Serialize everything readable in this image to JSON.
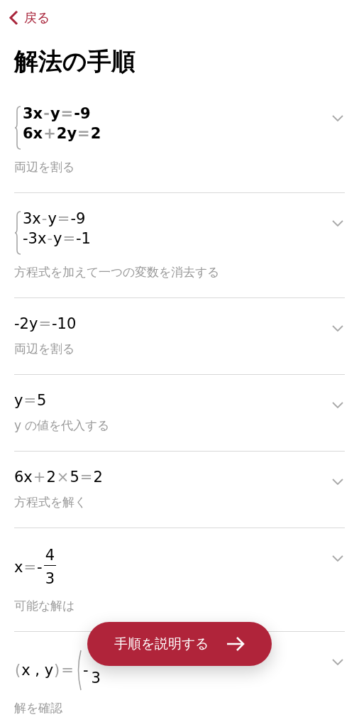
{
  "nav": {
    "back_label": "戻る"
  },
  "title": "解法の手順",
  "steps": [
    {
      "kind": "system",
      "bold": true,
      "expanded": false,
      "lines": [
        [
          {
            "t": "3x",
            "kind": "term"
          },
          {
            "t": "-",
            "kind": "op"
          },
          {
            "t": "y",
            "kind": "term"
          },
          {
            "t": "=",
            "kind": "op"
          },
          {
            "t": "-9",
            "kind": "term"
          }
        ],
        [
          {
            "t": "6x",
            "kind": "term"
          },
          {
            "t": "+",
            "kind": "op"
          },
          {
            "t": "2y",
            "kind": "term"
          },
          {
            "t": "=",
            "kind": "op"
          },
          {
            "t": "2",
            "kind": "term"
          }
        ]
      ],
      "note": "両辺を割る"
    },
    {
      "kind": "system",
      "bold": false,
      "expanded": false,
      "lines": [
        [
          {
            "t": "3x",
            "kind": "term"
          },
          {
            "t": "-",
            "kind": "op"
          },
          {
            "t": "y",
            "kind": "term"
          },
          {
            "t": "=",
            "kind": "op"
          },
          {
            "t": "-9",
            "kind": "term"
          }
        ],
        [
          {
            "t": "-3x",
            "kind": "term"
          },
          {
            "t": "-",
            "kind": "op"
          },
          {
            "t": "y",
            "kind": "term"
          },
          {
            "t": "=",
            "kind": "op"
          },
          {
            "t": "-1",
            "kind": "term"
          }
        ]
      ],
      "note": "方程式を加えて一つの変数を消去する"
    },
    {
      "kind": "line",
      "bold": false,
      "expanded": false,
      "lines": [
        [
          {
            "t": "-2y",
            "kind": "term"
          },
          {
            "t": "=",
            "kind": "op"
          },
          {
            "t": "-10",
            "kind": "term"
          }
        ]
      ],
      "note": "両辺を割る"
    },
    {
      "kind": "line",
      "bold": false,
      "expanded": false,
      "lines": [
        [
          {
            "t": "y",
            "kind": "term"
          },
          {
            "t": "=",
            "kind": "op"
          },
          {
            "t": "5",
            "kind": "term"
          }
        ]
      ],
      "note": "y の値を代入する"
    },
    {
      "kind": "line",
      "bold": false,
      "expanded": false,
      "lines": [
        [
          {
            "t": "6x",
            "kind": "term"
          },
          {
            "t": "+",
            "kind": "op"
          },
          {
            "t": "2",
            "kind": "term"
          },
          {
            "t": "×",
            "kind": "op"
          },
          {
            "t": "5",
            "kind": "term"
          },
          {
            "t": "=",
            "kind": "op"
          },
          {
            "t": "2",
            "kind": "term"
          }
        ]
      ],
      "note": "方程式を解く"
    },
    {
      "kind": "line",
      "bold": false,
      "expanded": false,
      "lines": [
        [
          {
            "t": "x",
            "kind": "term"
          },
          {
            "t": "=",
            "kind": "op"
          },
          {
            "t": "-",
            "kind": "term"
          }
        ]
      ],
      "fraction": {
        "num": "4",
        "den": "3"
      },
      "note": "可能な解は"
    },
    {
      "kind": "line",
      "bold": false,
      "expanded": false,
      "lines": [
        [
          {
            "t": "(",
            "kind": "op"
          },
          {
            "t": "x , y",
            "kind": "term"
          },
          {
            "t": ")",
            "kind": "op"
          },
          {
            "t": "=",
            "kind": "op"
          },
          {
            "kind": "lparen"
          },
          {
            "t": "-",
            "kind": "term"
          }
        ]
      ],
      "fraction": {
        "den": "3"
      },
      "note": "解を確認"
    }
  ],
  "action_button": {
    "label": "手順を説明する"
  }
}
